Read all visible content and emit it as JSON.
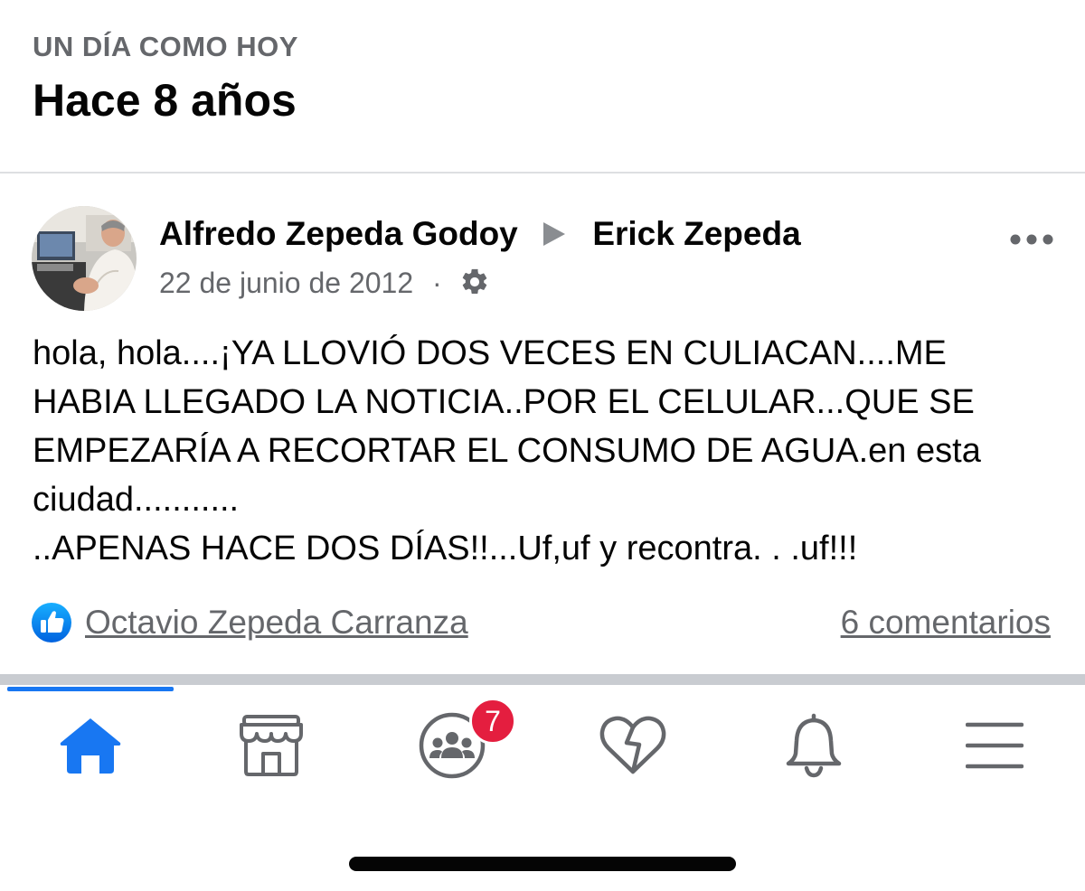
{
  "memory": {
    "kicker": "UN DÍA COMO HOY",
    "title": "Hace 8 años"
  },
  "post": {
    "author": "Alfredo Zepeda Godoy",
    "recipient": "Erick Zepeda",
    "date": "22 de junio de 2012",
    "separator": "·",
    "privacy_icon": "gear-icon",
    "more_icon": "more-options-icon",
    "body": "hola, hola....¡YA LLOVIÓ DOS VECES EN CULIACAN....ME HABIA LLEGADO LA NOTICIA..POR EL CELULAR...QUE SE EMPEZARÍA A RECORTAR EL CONSUMO DE AGUA.en esta ciudad...........\n..APENAS HACE DOS DÍAS!!...Uf,uf y recontra. . .uf!!!"
  },
  "reactions": {
    "icon": "like-icon",
    "liker": "Octavio Zepeda Carranza",
    "comments": "6 comentarios"
  },
  "nav": {
    "tabs": [
      {
        "name": "home",
        "icon": "home-icon",
        "active": true
      },
      {
        "name": "marketplace",
        "icon": "marketplace-icon",
        "active": false
      },
      {
        "name": "groups",
        "icon": "groups-icon",
        "active": false,
        "badge": "7"
      },
      {
        "name": "dating",
        "icon": "heart-icon",
        "active": false
      },
      {
        "name": "notifications",
        "icon": "bell-icon",
        "active": false
      },
      {
        "name": "menu",
        "icon": "menu-icon",
        "active": false
      }
    ]
  },
  "colors": {
    "accent": "#1877f2",
    "secondary_text": "#65676b",
    "badge": "#e41e3f",
    "icon_gray": "#65676b"
  }
}
